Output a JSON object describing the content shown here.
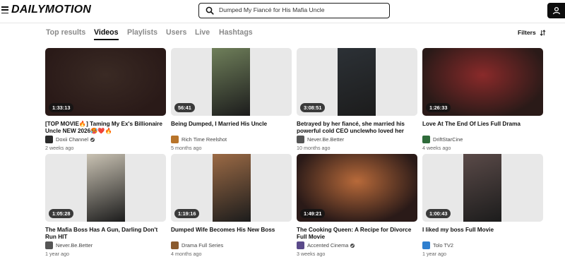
{
  "header": {
    "logo": "DAILYMOTION",
    "search_value": "Dumped My Fiancé for His Mafia Uncle"
  },
  "tabs": [
    {
      "label": "Top results",
      "active": false
    },
    {
      "label": "Videos",
      "active": true
    },
    {
      "label": "Playlists",
      "active": false
    },
    {
      "label": "Users",
      "active": false
    },
    {
      "label": "Live",
      "active": false
    },
    {
      "label": "Hashtags",
      "active": false
    }
  ],
  "filters_label": "Filters",
  "videos": [
    {
      "duration": "1:33:13",
      "title": "[TOP MOVIE🔥] Taming My Ex's Billionaire Uncle NEW 2026🥵❤️🔥",
      "channel": "Doxii Channel",
      "verified": true,
      "age": "2 weeks ago",
      "thumb_color": "#3a2a24",
      "avatar_color": "#2b2b2b"
    },
    {
      "duration": "56:41",
      "title": "Being Dumped, I Married His Uncle",
      "channel": "Rich Time Reelshot",
      "verified": false,
      "age": "5 months ago",
      "thumb_color": "#6f7f5a",
      "avatar_color": "#b8742a"
    },
    {
      "duration": "3:08:51",
      "title": "Betrayed by her fiancé, she married his powerful cold CEO unclewho loved her with...",
      "channel": "Never.Be.Better",
      "verified": false,
      "age": "10 months ago",
      "thumb_color": "#2c3136",
      "avatar_color": "#555"
    },
    {
      "duration": "1:26:33",
      "title": "Love At The End Of Lies Full Drama",
      "channel": "DriftStarCine",
      "verified": false,
      "age": "4 weeks ago",
      "thumb_color": "#8a2a2a",
      "avatar_color": "#2f6b3a"
    },
    {
      "duration": "1:05:28",
      "title": "The Mafia Boss Has A Gun, Darling Don't Run HIT",
      "channel": "Never.Be.Better",
      "verified": false,
      "age": "1 year ago",
      "thumb_color": "#c9c2b3",
      "avatar_color": "#555"
    },
    {
      "duration": "1:19:16",
      "title": "Dumped Wife Becomes His New Boss",
      "channel": "Drama Full Series",
      "verified": false,
      "age": "4 months ago",
      "thumb_color": "#9b6a45",
      "avatar_color": "#8a5a2e"
    },
    {
      "duration": "1:49:21",
      "title": "The Cooking Queen: A Recipe for Divorce Full Movie",
      "channel": "Accented Cinema",
      "verified": true,
      "age": "3 weeks ago",
      "thumb_color": "#b86a3a",
      "avatar_color": "#5a4a8a"
    },
    {
      "duration": "1:00:43",
      "title": "I liked my boss Full Movie",
      "channel": "Tolo TV2",
      "verified": false,
      "age": "1 year ago",
      "thumb_color": "#5a4a48",
      "avatar_color": "#2f7fcf"
    }
  ]
}
